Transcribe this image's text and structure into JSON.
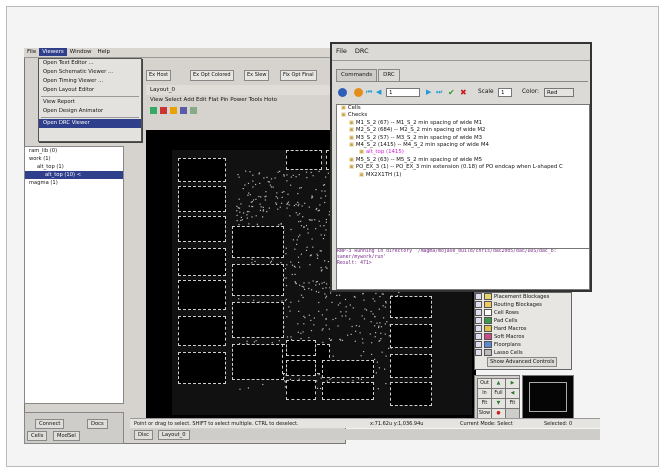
{
  "main_menu": [
    "File",
    "Viewers",
    "Window",
    "Help"
  ],
  "viewers_menu": [
    "Open Text Editor ...",
    "Open Schematic Viewer ...",
    "Open Timing Viewer ...",
    "Open Layout Editor",
    "View Report",
    "Open Design Animator",
    "Open DRC Viewer"
  ],
  "layout_menu": [
    "View",
    "Select",
    "Add",
    "Edit",
    "Flat",
    "Pin",
    "Power",
    "Tools",
    "Hoto"
  ],
  "toolbar_buttons": [
    "Ex Host",
    "Ex Opt Colored",
    "Ex Slew",
    "Fix Opt Final"
  ],
  "layout_title": "Layout_0",
  "tree_items": [
    "ram_lib (0)",
    "work (1)",
    "alt_top (1)",
    "alt_top (10) <",
    "magma (1)"
  ],
  "drc": {
    "menu": [
      "File",
      "DRC"
    ],
    "tabs": [
      "Commands",
      "DRC"
    ],
    "page_field": "1",
    "scale_label": "Scale",
    "scale_value": "1",
    "color_label": "Color:",
    "color_value": "Red",
    "items": [
      "Cells",
      "Checks",
      "M1_S_2 (67) -- M1_S_2 min spacing of wide M1",
      "M2_S_2 (684) -- M2_S_2 min spacing of wide M2",
      "M3_S_2 (57) -- M3_S_2 min spacing of wide M3",
      "M4_S_2 (1415) -- M4_S_2 min spacing of wide M4",
      "alt_top (1415)",
      "M5_S_2 (63) -- M5_S_2 min spacing of wide M5",
      "PO_EX_3 (1) -- PO_EX_3 min extension (0.18) of PO endcap when L-shaped C",
      "MX2X1TH (1)"
    ],
    "console": [
      "RNP-3  Running in directory '/magma/mojave_build/chris/dac2005/dac/DDS/dac_b:",
      "saner/mywork/run'",
      "Result: 471>"
    ]
  },
  "legend_items": [
    "Placement Blockages",
    "Routing Blockages",
    "Cell Rows",
    "Pad Cells",
    "Hard Macros",
    "Soft Macros",
    "Floorplans",
    "Lasso Cells"
  ],
  "legend_button": "Show Advanced Controls",
  "nav_buttons": [
    "Out",
    "In",
    "Full",
    "Fit",
    "Fit",
    "Slow"
  ],
  "status": {
    "hint": "Point or drag to select. SHIFT to select multiple. CTRL to deselect.",
    "coords": "x:71.62u y:1,036.94u",
    "mode": "Current Mode: Select",
    "selected": "Selected: 0"
  },
  "bottom_tabs": [
    "Connect",
    "Docs",
    "Cells",
    "ModSel"
  ],
  "taskbar": [
    "Disc",
    "Layout_0"
  ]
}
